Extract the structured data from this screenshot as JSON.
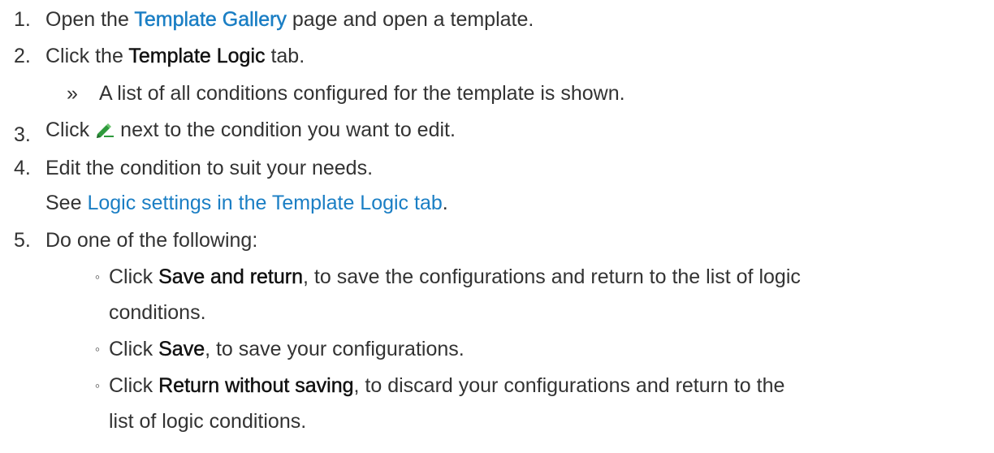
{
  "steps": [
    {
      "number": "1.",
      "before": "Open the ",
      "link": "Template Gallery",
      "after": " page and open a template."
    },
    {
      "number": "2.",
      "before": "Click the ",
      "bold": "Template Logic",
      "after": " tab.",
      "result_marker": "»",
      "result": "A list of all conditions configured for the template is shown."
    },
    {
      "number": "3.",
      "before": "Click",
      "icon": "edit-pencil-icon",
      "after": "next to the condition you want to edit."
    },
    {
      "number": "4.",
      "text": "Edit the condition to suit your needs.",
      "see_prefix": "See ",
      "see_link": "Logic settings in the Template Logic tab",
      "see_suffix": "."
    },
    {
      "number": "5.",
      "text": "Do one of the following:",
      "options": [
        {
          "marker": "◦",
          "before": "Click ",
          "bold": "Save and return",
          "after_line1": ", to save the configurations and return to the list of logic",
          "after_line2": "conditions."
        },
        {
          "marker": "◦",
          "before": "Click ",
          "bold": "Save",
          "after_line1": ", to save your configurations."
        },
        {
          "marker": "◦",
          "before": "Click ",
          "bold": "Return without saving",
          "after_line1": ", to discard your configurations and return to the",
          "after_line2": "list of logic conditions."
        }
      ]
    }
  ],
  "colors": {
    "text": "#333333",
    "link": "#1a7ec4",
    "icon_green": "#2e9a3c"
  }
}
